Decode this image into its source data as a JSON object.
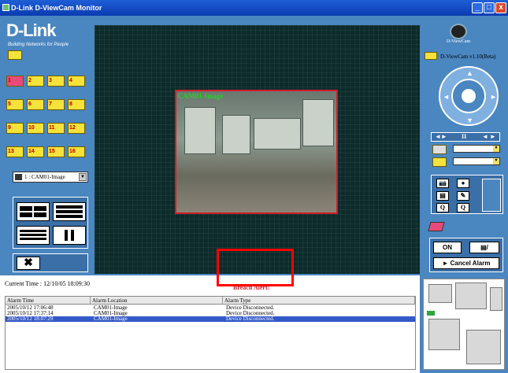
{
  "window": {
    "title": "D-Link D-ViewCam Monitor",
    "minimize": "_",
    "maximize": "□",
    "close": "x"
  },
  "brand": {
    "logo": "D-Link",
    "tagline": "Building Networks for People"
  },
  "cameras": [
    "1",
    "2",
    "3",
    "4",
    "5",
    "6",
    "7",
    "8",
    "9",
    "10",
    "11",
    "12",
    "13",
    "14",
    "15",
    "16"
  ],
  "camera_select": {
    "value": "1 : CAM01-Image",
    "arrow": "▼"
  },
  "close_button": "✖",
  "viewer": {
    "camera_label": "CAM01-Image"
  },
  "right_panel": {
    "logo_text": "D-ViewCam",
    "version": "D-ViewCam v1.10(Beta)",
    "ptz_row": {
      "left_right": "◄►",
      "pause": "II",
      "step": "◄ ►"
    },
    "snap": {
      "camera": "📷",
      "record": "●",
      "film": "▤",
      "edit": "✎",
      "zoom_out": "Q",
      "zoom_in": "Q"
    },
    "alarm_on": "ON",
    "alarm_note": "▤/",
    "cancel_alarm": "► Cancel Alarm"
  },
  "status": {
    "current_time": "Current Time : 12/10/05 18:09:30",
    "breach": "Breach Alert!"
  },
  "alarm_table": {
    "headers": [
      "Alarm Time",
      "Alarm Location",
      "Alarm Type"
    ],
    "rows": [
      {
        "time": "2005/10/12 17:06:48",
        "location": "CAM01-Image",
        "type": "Device Disconnected."
      },
      {
        "time": "2005/10/12 17:37:14",
        "location": "CAM01-Image",
        "type": "Device Disconnected."
      },
      {
        "time": "2005/10/12 18:07:29",
        "location": "CAM01-Image",
        "type": "Device Disconnected."
      }
    ]
  },
  "colors": {
    "app_bg": "#4a86c0",
    "alert_red": "#d21c2a",
    "title_blue": "#0a3bb0"
  }
}
